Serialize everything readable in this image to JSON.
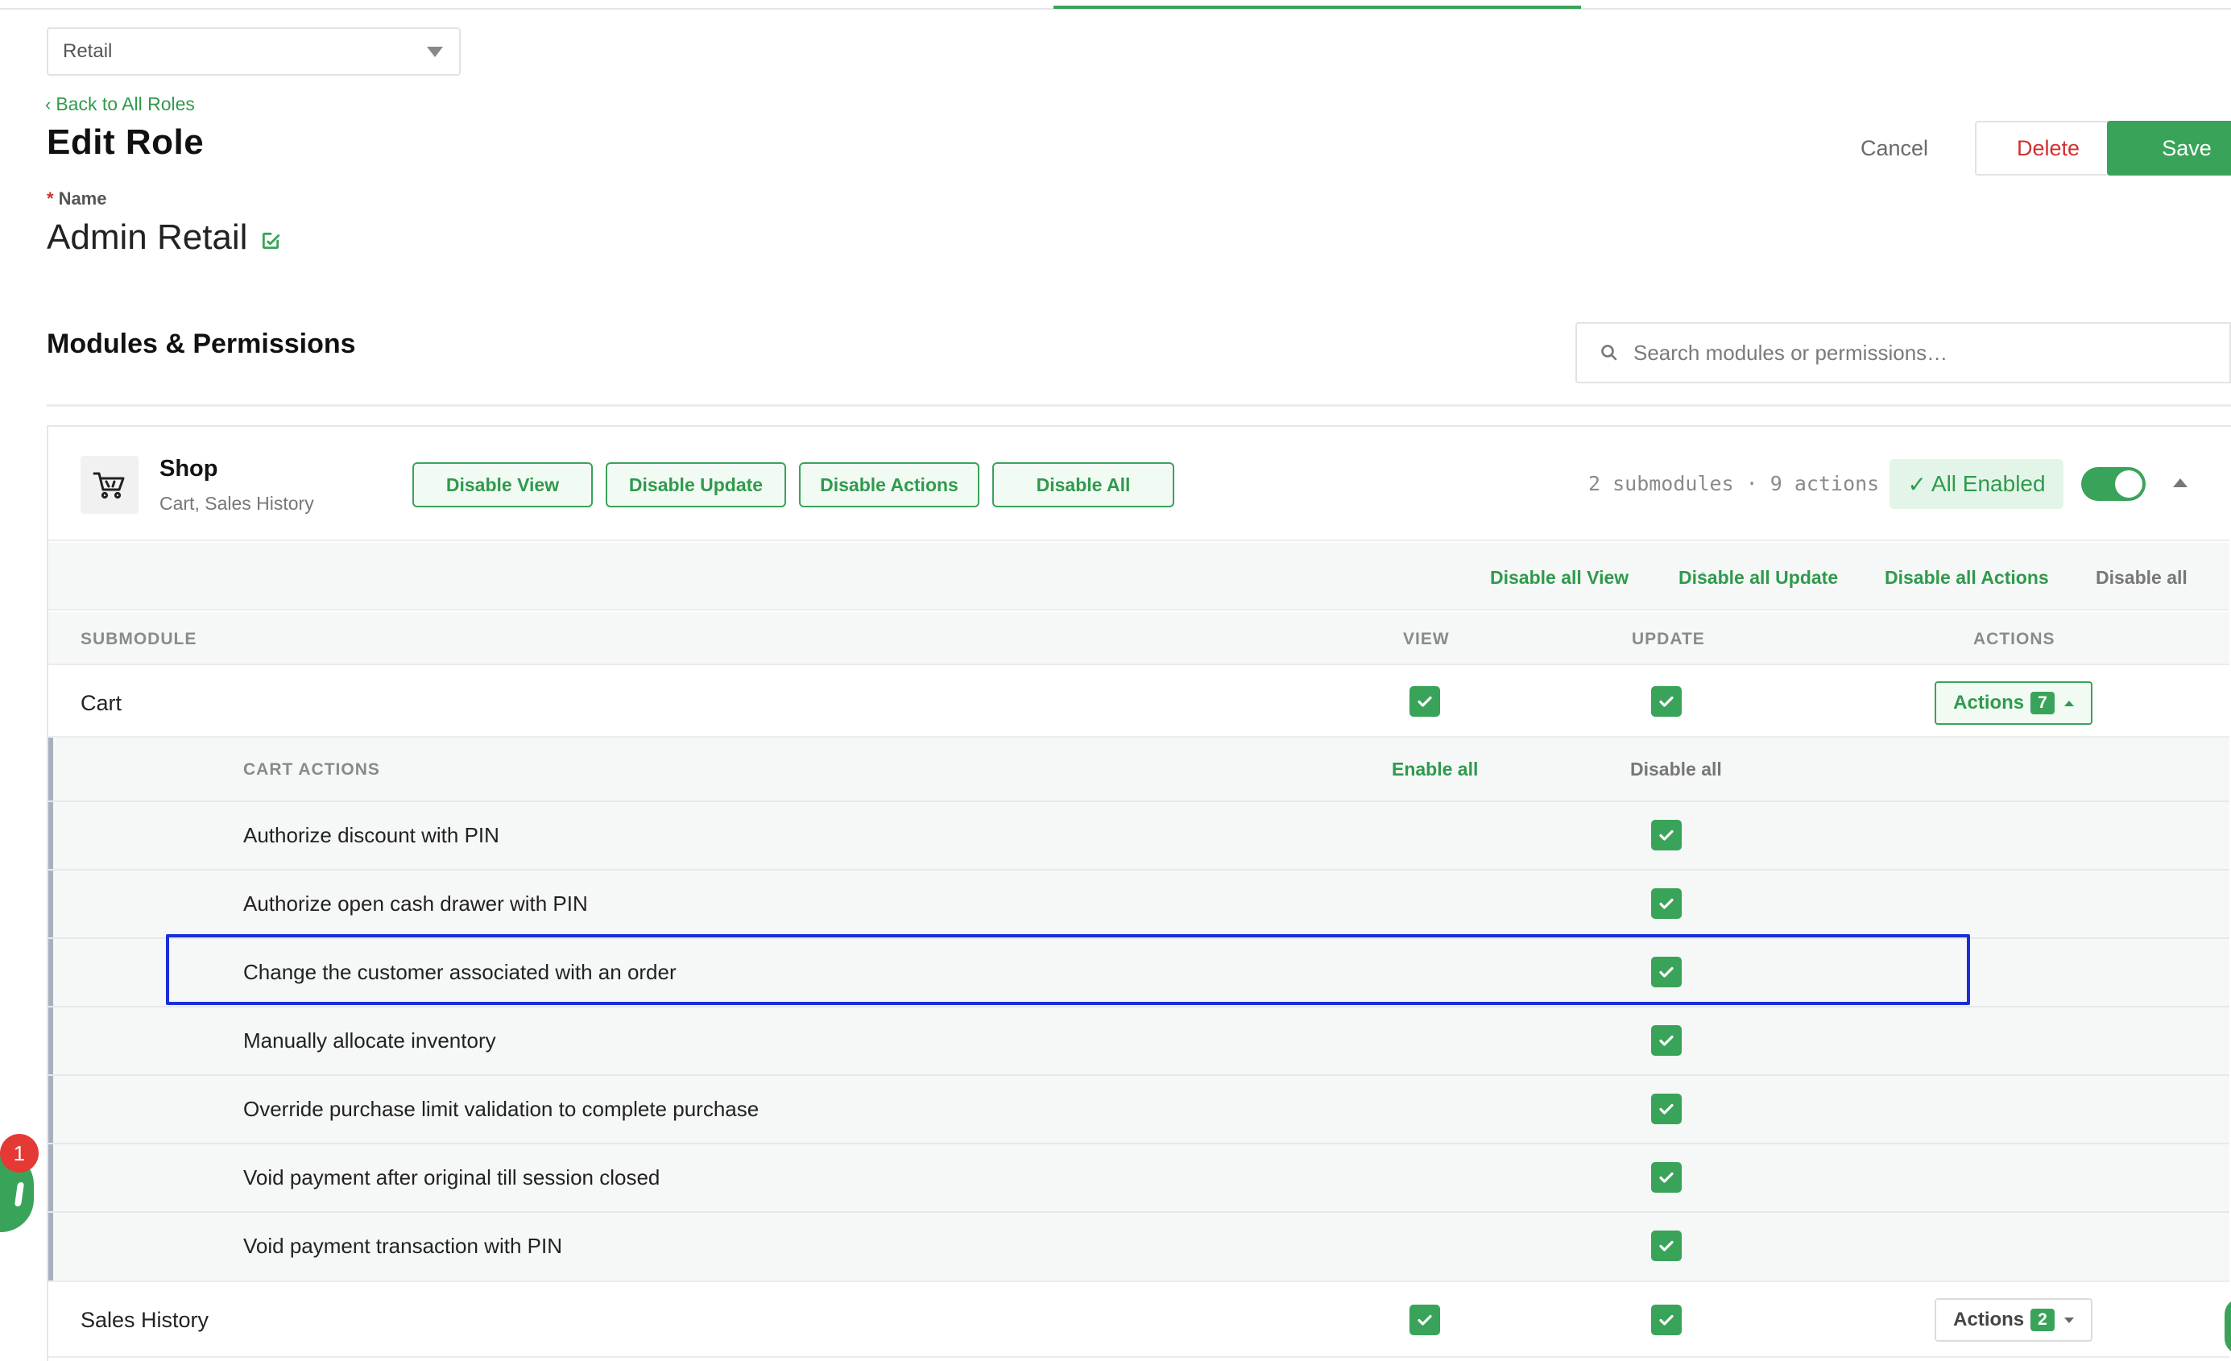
{
  "store_select": {
    "value": "Retail"
  },
  "header": {
    "back_link": "Back to All Roles",
    "title": "Edit Role",
    "cancel_label": "Cancel",
    "delete_label": "Delete",
    "save_label": "Save"
  },
  "role": {
    "name_label": "Name",
    "required_mark": "*",
    "name_value": "Admin Retail"
  },
  "permissions": {
    "section_title": "Modules & Permissions",
    "search_placeholder": "Search modules or permissions…"
  },
  "module": {
    "title": "Shop",
    "subtitle": "Cart, Sales History",
    "buttons": [
      "Disable View",
      "Disable Update",
      "Disable Actions",
      "Disable All"
    ],
    "counts": "2 submodules · 9 actions",
    "status": "All Enabled",
    "status_check": "✓",
    "enabled": true,
    "bulk_links": [
      "Disable all View",
      "Disable all Update",
      "Disable all Actions",
      "Disable all"
    ],
    "columns": [
      "SUBMODULE",
      "VIEW",
      "UPDATE",
      "ACTIONS"
    ],
    "submodules": [
      {
        "name": "Cart",
        "view": true,
        "update": true,
        "actions_label": "Actions",
        "actions_count": "7",
        "expanded": true
      },
      {
        "name": "Sales History",
        "view": true,
        "update": true,
        "actions_label": "Actions",
        "actions_count": "2",
        "expanded": false
      }
    ],
    "cart_actions": {
      "title": "CART ACTIONS",
      "enable_all": "Enable all",
      "disable_all": "Disable all",
      "items": [
        {
          "label": "Authorize discount with PIN",
          "enabled": true
        },
        {
          "label": "Authorize open cash drawer with PIN",
          "enabled": true
        },
        {
          "label": "Change the customer associated with an order",
          "enabled": true
        },
        {
          "label": "Manually allocate inventory",
          "enabled": true
        },
        {
          "label": "Override purchase limit validation to complete purchase",
          "enabled": true
        },
        {
          "label": "Void payment after original till session closed",
          "enabled": true
        },
        {
          "label": "Void payment transaction with PIN",
          "enabled": true
        }
      ]
    }
  },
  "chat": {
    "notification_count": "1"
  },
  "colors": {
    "accent": "#3aa35a",
    "danger": "#d32f2f",
    "highlight": "#1a2fd8"
  },
  "icons": [
    "chevron-down-icon",
    "chevron-left-icon",
    "edit-icon",
    "search-icon",
    "cart-icon",
    "check-icon",
    "caret-up-icon",
    "chat-icon"
  ]
}
